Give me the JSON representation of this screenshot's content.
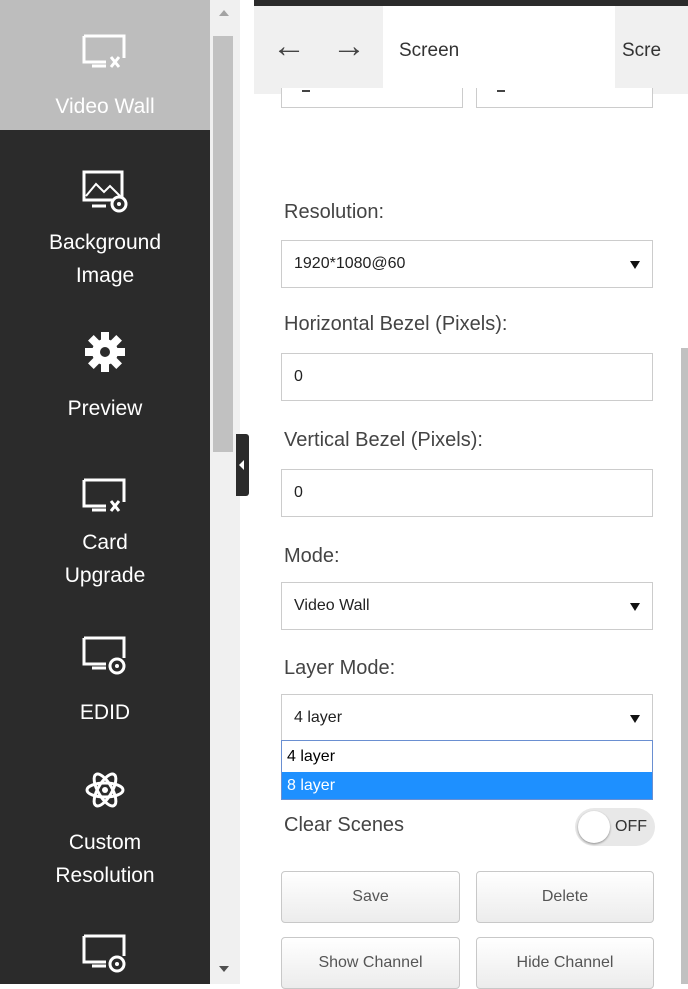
{
  "sidebar": {
    "items": [
      {
        "label": "Video Wall",
        "icon": "monitor-tools-icon",
        "active": true
      },
      {
        "label": "Background\nImage",
        "icon": "monitor-image-gear-icon",
        "active": false
      },
      {
        "label": "Preview",
        "icon": "gear-icon",
        "active": false
      },
      {
        "label": "Card\nUpgrade",
        "icon": "monitor-tools-icon",
        "active": false
      },
      {
        "label": "EDID",
        "icon": "monitor-gear-icon",
        "active": false
      },
      {
        "label": "Custom\nResolution",
        "icon": "atom-icon",
        "active": false
      },
      {
        "label": "",
        "icon": "monitor-gear-icon",
        "active": false
      }
    ]
  },
  "tabs": [
    {
      "label": "Screen",
      "active": true
    },
    {
      "label": "Scre",
      "active": false
    }
  ],
  "form": {
    "resolution": {
      "label": "Resolution:",
      "value": "1920*1080@60"
    },
    "horizontal_bezel": {
      "label": "Horizontal Bezel (Pixels):",
      "value": "0"
    },
    "vertical_bezel": {
      "label": "Vertical Bezel (Pixels):",
      "value": "0"
    },
    "mode": {
      "label": "Mode:",
      "value": "Video Wall"
    },
    "layer_mode": {
      "label": "Layer Mode:",
      "value": "4 layer",
      "options": [
        "4 layer",
        "8 layer"
      ],
      "highlighted": "8 layer"
    },
    "clear_scenes": {
      "label": "Clear Scenes",
      "state": "OFF"
    }
  },
  "buttons": {
    "save": "Save",
    "delete": "Delete",
    "show_channel": "Show Channel",
    "hide_channel": "Hide Channel"
  },
  "colors": {
    "sidebar_bg": "#2b2b2b",
    "sidebar_active_bg": "#bdbdbd",
    "highlight": "#1e90ff"
  }
}
